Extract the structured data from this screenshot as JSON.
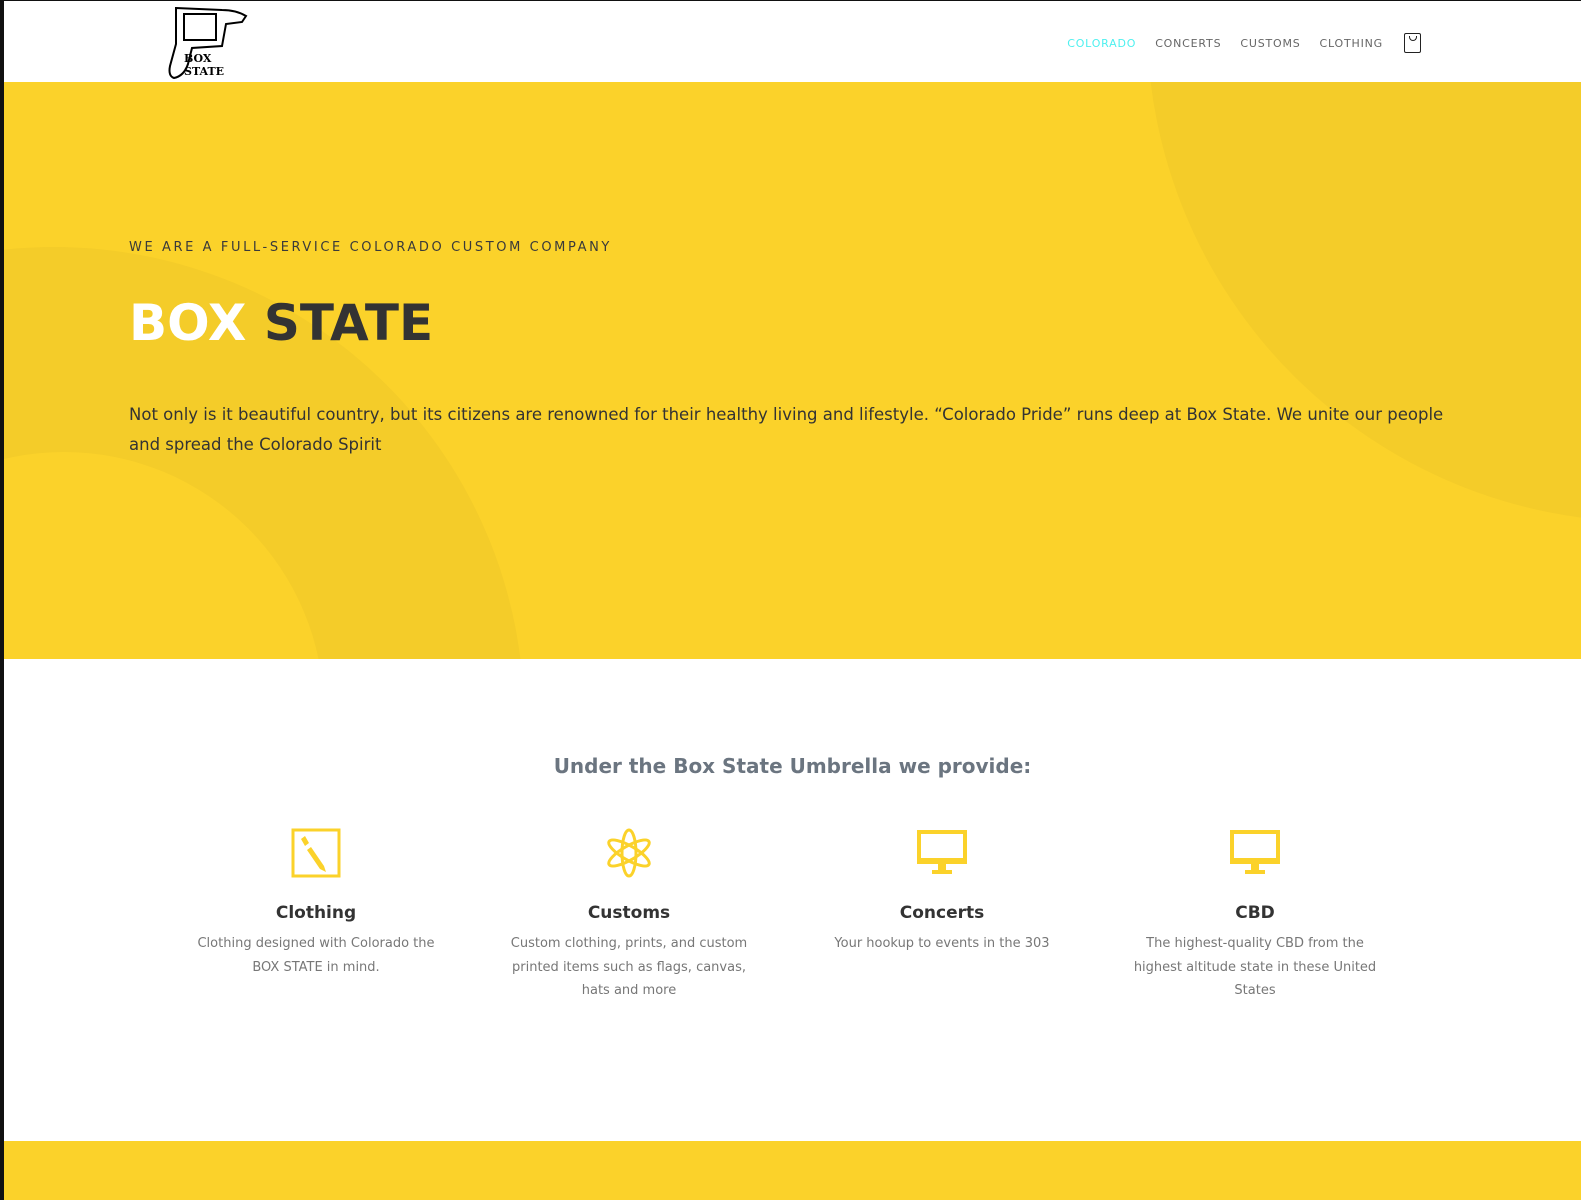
{
  "header": {
    "logo_text": "BOX STATE",
    "nav": [
      {
        "label": "COLORADO",
        "active": true
      },
      {
        "label": "CONCERTS"
      },
      {
        "label": "CUSTOMS"
      },
      {
        "label": "CLOTHING"
      }
    ]
  },
  "hero": {
    "eyebrow": "WE ARE A FULL-SERVICE COLORADO CUSTOM COMPANY",
    "title_white": "BOX",
    "title_dark": "STATE",
    "description": "Not only is it beautiful country, but its citizens are renowned for their healthy living and lifestyle. “Colorado Pride” runs deep at Box State. We unite our people and spread the Colorado Spirit"
  },
  "services": {
    "heading": "Under the Box State Umbrella we provide:",
    "items": [
      {
        "title": "Clothing",
        "text": "Clothing designed with Colorado the BOX STATE in mind.",
        "icon": "pencil-box-icon"
      },
      {
        "title": "Customs",
        "text": "Custom clothing, prints, and custom printed items such as flags, canvas, hats and more",
        "icon": "atom-icon"
      },
      {
        "title": "Concerts",
        "text": "Your hookup to events in the 303",
        "icon": "monitor-icon"
      },
      {
        "title": "CBD",
        "text": "The highest-quality CBD from the highest altitude state in these United States",
        "icon": "monitor-icon"
      }
    ]
  },
  "colors": {
    "accent": "#fbd22a",
    "nav_active": "#4ef0ef"
  }
}
